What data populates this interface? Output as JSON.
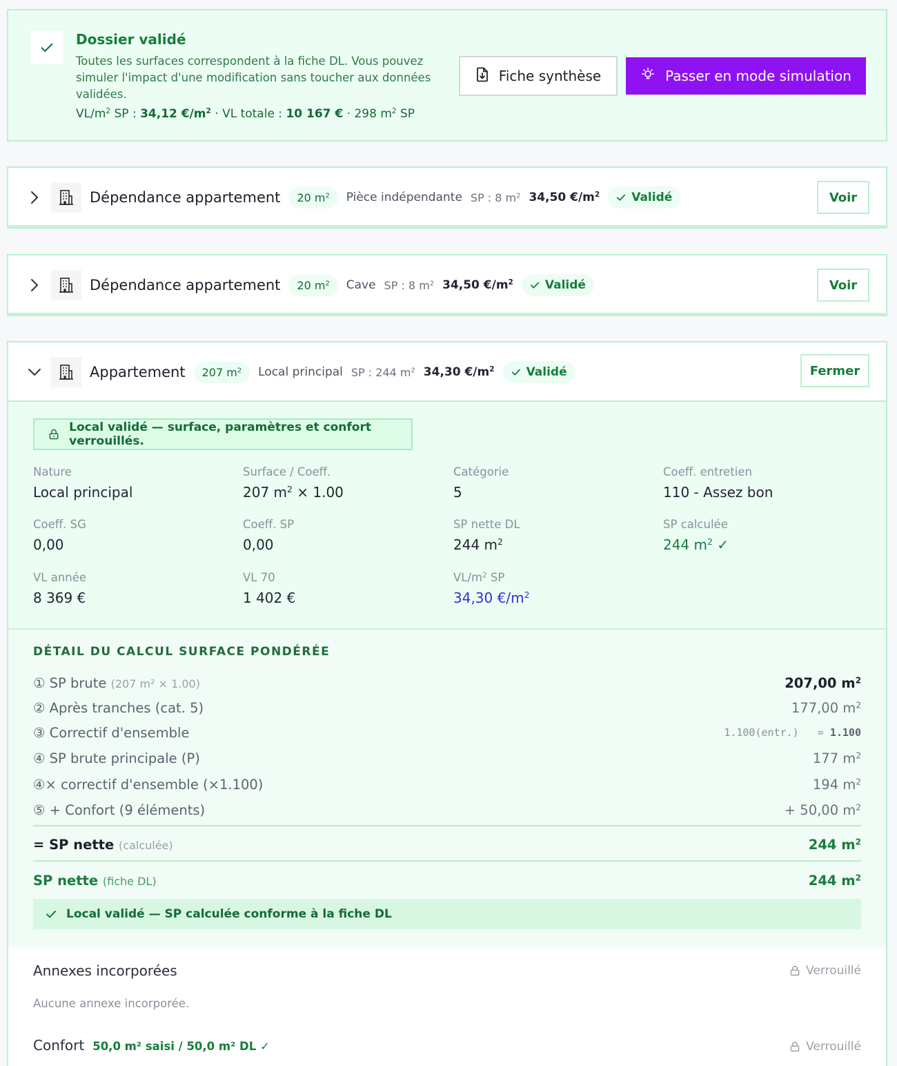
{
  "banner": {
    "title": "Dossier validé",
    "description": "Toutes les surfaces correspondent à la fiche DL. Vous pouvez simuler l'impact d'une modification sans toucher aux données validées.",
    "stats": {
      "vl_label": "VL/m",
      "vl_label2": " SP : ",
      "vl_value": "34,12 €/m",
      "sep1": " · VL totale : ",
      "total_value": "10 167 €",
      "sep2": " · 298 m",
      "sp_suffix": " SP"
    },
    "fiche_button": "Fiche synthèse",
    "simulation_button": "Passer en mode simulation"
  },
  "locals": [
    {
      "name": "Dépendance appartement",
      "area": "20 m",
      "kind": "Pièce indépendante",
      "sp": "SP : 8 m",
      "vlm": "34,50 €/m",
      "status": "Validé",
      "action": "Voir"
    },
    {
      "name": "Dépendance appartement",
      "area": "20 m",
      "kind": "Cave",
      "sp": "SP : 8 m",
      "vlm": "34,50 €/m",
      "status": "Validé",
      "action": "Voir"
    },
    {
      "name": "Appartement",
      "area": "207 m",
      "kind": "Local principal",
      "sp": "SP : 244 m",
      "vlm": "34,30 €/m",
      "status": "Validé",
      "action": "Fermer"
    }
  ],
  "superscript": "2",
  "detail": {
    "lock_message": "Local validé — surface, paramètres et confort verrouillés.",
    "fields": {
      "nature_label": "Nature",
      "nature_value": "Local principal",
      "surface_label": "Surface / Coeff.",
      "surface_value_a": "207 m",
      "surface_value_b": " × 1.00",
      "categorie_label": "Catégorie",
      "categorie_value": "5",
      "entretien_label": "Coeff. entretien",
      "entretien_value": "110 - Assez bon",
      "sg_label": "Coeff. SG",
      "sg_value": "0,00",
      "csp_label": "Coeff. SP",
      "csp_value": "0,00",
      "spdl_label": "SP nette DL",
      "spdl_value": "244 m",
      "spcalc_label": "SP calculée",
      "spcalc_value": "244 m",
      "spcalc_check": " ✓",
      "vlannee_label": "VL année",
      "vlannee_value": "8 369 €",
      "vl70_label": "VL 70",
      "vl70_value": "1 402 €",
      "vlmsp_label": "VL/m",
      "vlmsp_label2": " SP",
      "vlmsp_value": "34,30 €/m"
    }
  },
  "calc": {
    "title": "DÉTAIL DU CALCUL SURFACE PONDÉRÉE",
    "rows": [
      {
        "label": "① SP brute",
        "sub": "(207 m² × 1.00)",
        "value": "207,00 m"
      },
      {
        "label": "② Après tranches (cat. 5)",
        "value": "177,00 m"
      },
      {
        "label": "③ Correctif d'ensemble",
        "mono_a": "1.100(entr.)",
        "mono_b": "= ",
        "mono_c": "1.100"
      },
      {
        "label": "④ SP brute principale (P)",
        "value": "177 m"
      },
      {
        "label": "④× correctif d'ensemble (×1.100)",
        "value": "194 m"
      },
      {
        "label": "⑤ + Confort (9 éléments)",
        "value": "+ 50,00 m"
      }
    ],
    "total": {
      "label": "= SP nette",
      "sub": "(calculée)",
      "value": "244 m"
    },
    "dl": {
      "label": "SP nette",
      "sub": "(fiche DL)",
      "value": "244 m"
    },
    "ok_message": "Local validé — SP calculée conforme à la fiche DL"
  },
  "annexes": {
    "title": "Annexes incorporées",
    "empty": "Aucune annexe incorporée.",
    "locked": "Verrouillé",
    "confort_title": "Confort",
    "confort_status": "50,0 m² saisi / 50,0 m² DL ✓"
  },
  "colors": {
    "accent": "#8f12f2",
    "success": "#177d3c",
    "success_bg": "#ecfdf3",
    "link_blue": "#3b2fc9"
  },
  "icons": [
    "check-icon",
    "document-download-icon",
    "lightbulb-icon",
    "chevron-right-icon",
    "chevron-down-icon",
    "building-icon",
    "lock-icon"
  ]
}
